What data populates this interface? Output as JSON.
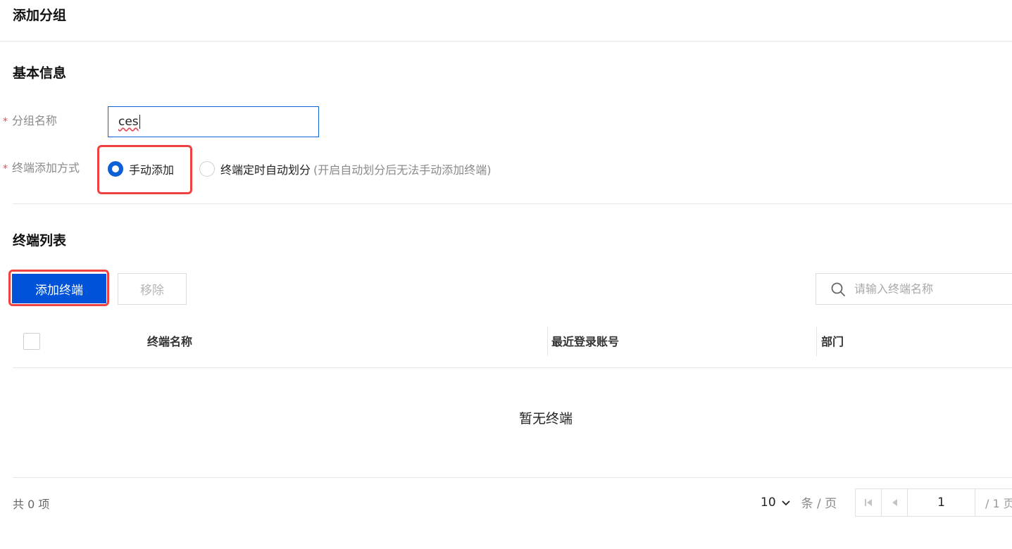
{
  "page": {
    "title": "添加分组"
  },
  "basic": {
    "title": "基本信息",
    "name": {
      "required_mark": "*",
      "label": "分组名称",
      "value": "ces"
    },
    "mode": {
      "required_mark": "*",
      "label": "终端添加方式",
      "options": [
        {
          "label": "手动添加",
          "selected": true
        },
        {
          "label": "终端定时自动划分",
          "hint": "(开启自动划分后无法手动添加终端)",
          "selected": false
        }
      ]
    }
  },
  "list": {
    "title": "终端列表",
    "add_button": "添加终端",
    "remove_button": "移除",
    "search_placeholder": "请输入终端名称",
    "columns": [
      "终端名称",
      "最近登录账号",
      "部门"
    ],
    "rows": [],
    "empty_text": "暂无终端"
  },
  "footer": {
    "total": "共 0 项",
    "page_size": "10",
    "page_size_unit": "条 / 页",
    "current_page": "1",
    "total_pages": "/ 1 页"
  },
  "colors": {
    "primary": "#0052d9",
    "highlight": "#f04141",
    "required": "#e34d59"
  }
}
